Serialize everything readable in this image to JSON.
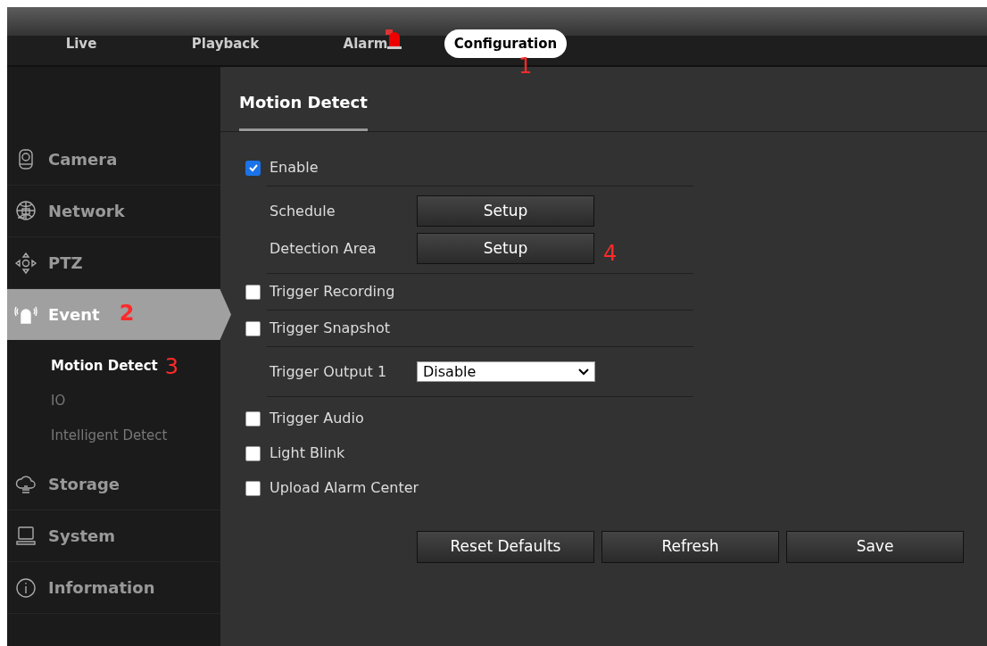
{
  "nav_tabs": [
    {
      "label": "Live",
      "selected": false,
      "alarm": false
    },
    {
      "label": "Playback",
      "selected": false,
      "alarm": false
    },
    {
      "label": "Alarm",
      "selected": false,
      "alarm": true
    },
    {
      "label": "Configuration",
      "selected": true,
      "alarm": false,
      "annotation": "1"
    }
  ],
  "sidebar": {
    "items": [
      {
        "label": "Camera",
        "selected": false
      },
      {
        "label": "Network",
        "selected": false
      },
      {
        "label": "PTZ",
        "selected": false
      },
      {
        "label": "Event",
        "selected": true,
        "annotation": "2",
        "children": [
          {
            "label": "Motion Detect",
            "selected": true,
            "annotation": "3"
          },
          {
            "label": "IO",
            "selected": false
          },
          {
            "label": "Intelligent Detect",
            "selected": false
          }
        ]
      },
      {
        "label": "Storage",
        "selected": false
      },
      {
        "label": "System",
        "selected": false
      },
      {
        "label": "Information",
        "selected": false
      }
    ]
  },
  "page": {
    "title": "Motion Detect",
    "groups": [
      {
        "rows": [
          {
            "kind": "checkbox",
            "label": "Enable",
            "checked": true
          }
        ]
      },
      {
        "rows": [
          {
            "kind": "button",
            "label": "Schedule",
            "button": "Setup"
          },
          {
            "kind": "button",
            "label": "Detection Area",
            "button": "Setup",
            "annotation": "4"
          }
        ]
      },
      {
        "rows": [
          {
            "kind": "checkbox",
            "label": "Trigger Recording",
            "checked": false
          }
        ]
      },
      {
        "rows": [
          {
            "kind": "checkbox",
            "label": "Trigger Snapshot",
            "checked": false
          }
        ]
      },
      {
        "rows": [
          {
            "kind": "select",
            "label": "Trigger Output 1",
            "value": "Disable"
          }
        ]
      },
      {
        "rows": [
          {
            "kind": "checkbox",
            "label": "Trigger Audio",
            "checked": false
          },
          {
            "kind": "checkbox",
            "label": "Light Blink",
            "checked": false
          },
          {
            "kind": "checkbox",
            "label": "Upload Alarm Center",
            "checked": false
          }
        ]
      }
    ],
    "buttons": [
      "Reset Defaults",
      "Refresh",
      "Save"
    ]
  }
}
